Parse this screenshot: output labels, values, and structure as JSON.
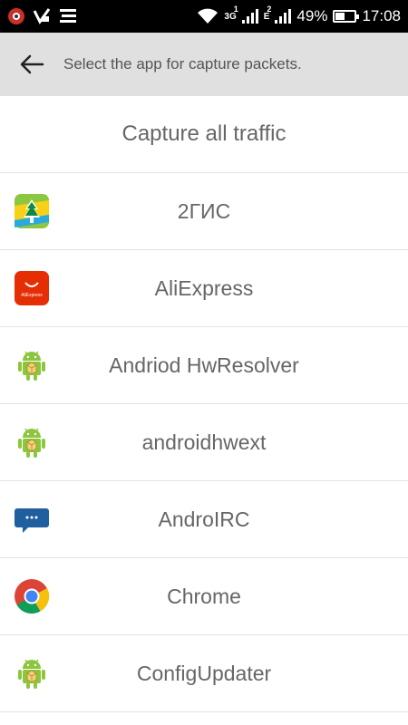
{
  "status_bar": {
    "network_1": "3G",
    "network_1_sim": "1",
    "network_2": "E",
    "network_2_sim": "2",
    "battery": "49%",
    "battery_level": 0.49,
    "time": "17:08"
  },
  "app_bar": {
    "title": "Select the app for capture packets."
  },
  "capture_all_label": "Capture all traffic",
  "apps": [
    {
      "name": "2ГИС",
      "icon": "2gis-icon"
    },
    {
      "name": "AliExpress",
      "icon": "aliexpress-icon",
      "icon_text": "AliExpress"
    },
    {
      "name": "Andriod HwResolver",
      "icon": "android-icon"
    },
    {
      "name": "androidhwext",
      "icon": "android-icon"
    },
    {
      "name": "AndroIRC",
      "icon": "androirc-icon"
    },
    {
      "name": "Chrome",
      "icon": "chrome-icon"
    },
    {
      "name": "ConfigUpdater",
      "icon": "android-icon"
    }
  ],
  "colors": {
    "status_bar": "#000000",
    "app_bar": "#e0e0e0",
    "text": "#666666",
    "divider": "#e2e2e2"
  }
}
